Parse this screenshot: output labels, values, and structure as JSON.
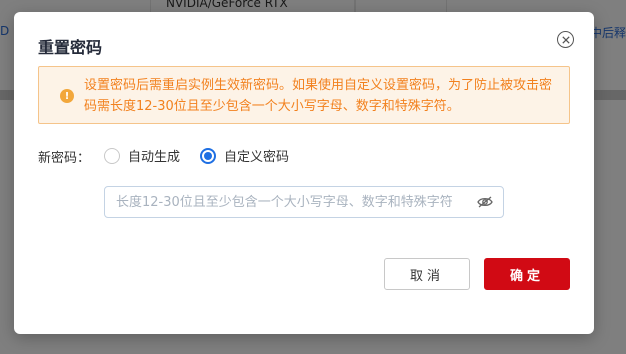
{
  "background": {
    "gpu_text": "NVIDIA/GeForce RTX",
    "left_glyph": "D",
    "right_text": "中后释"
  },
  "dialog": {
    "title": "重置密码",
    "alert_text": "设置密码后需重启实例生效新密码。如果使用自定义设置密码，为了防止被攻击密码需长度12-30位且至少包含一个大小写字母、数字和特殊字符。",
    "alert_icon": "!",
    "new_password_label": "新密码：",
    "radio_options": [
      "自动生成",
      "自定义密码"
    ],
    "selected_option": "自定义密码",
    "password_placeholder": "长度12-30位且至少包含一个大小写字母、数字和特殊字符",
    "cancel_label": "取消",
    "confirm_label": "确定"
  },
  "colors": {
    "primary": "#d10a14",
    "radio_accent": "#1e6fe3",
    "alert_text": "#f2811e",
    "alert_bg": "#fdf3e7"
  }
}
